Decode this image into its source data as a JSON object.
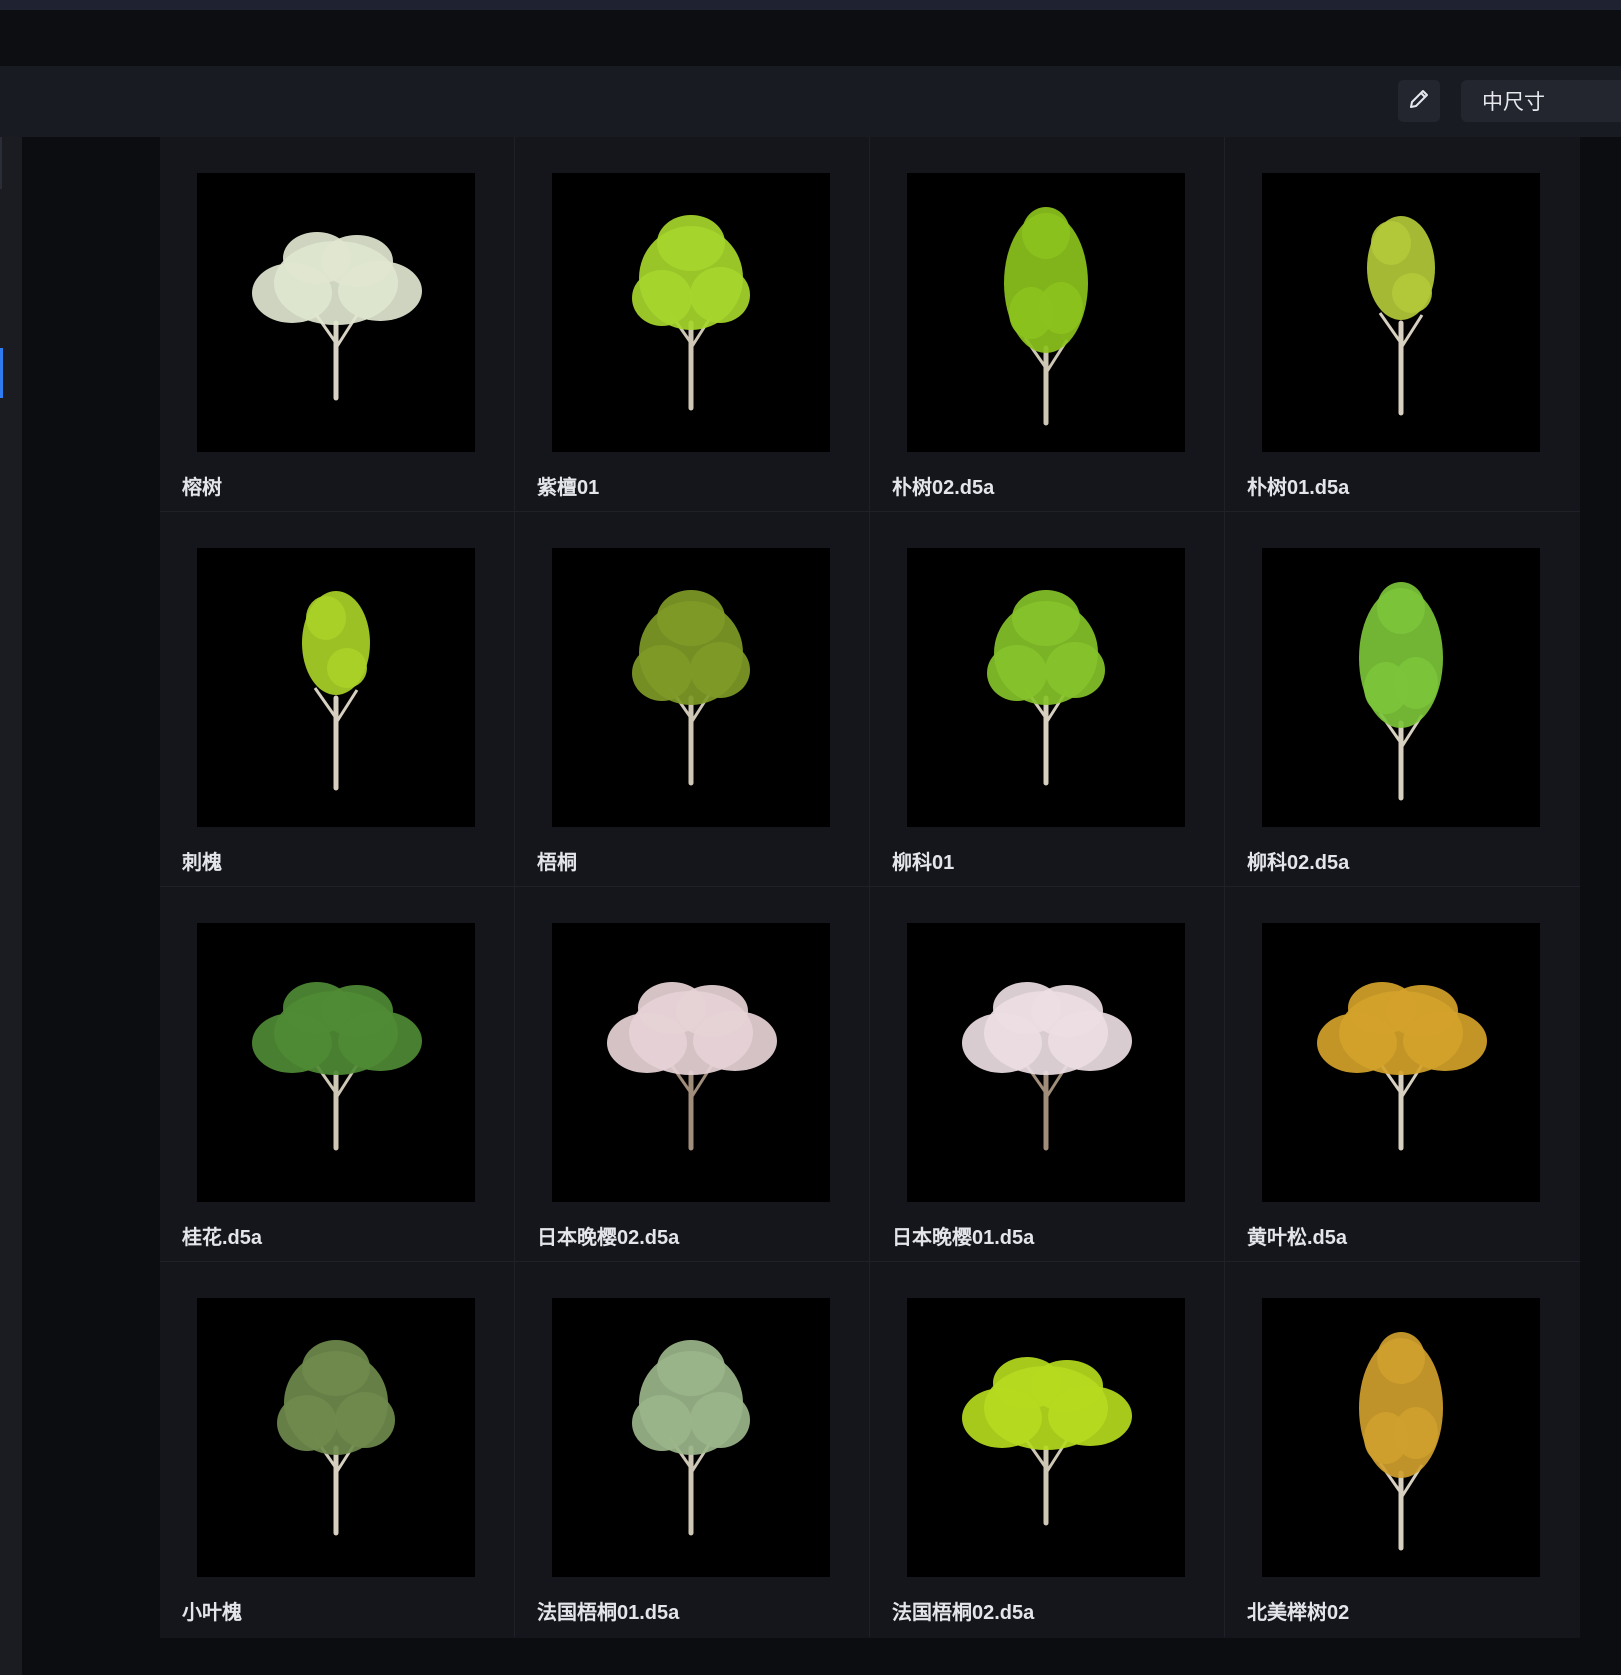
{
  "toolbar": {
    "edit_icon": "pencil-icon",
    "size_select": "中尺寸"
  },
  "assets": [
    {
      "label": "榕树",
      "foliage": "#dfe6cf",
      "trunk": "#d8d2c4",
      "shape": "wide"
    },
    {
      "label": "紫檀01",
      "foliage": "#a6d62c",
      "trunk": "#cfc7b5",
      "shape": "round"
    },
    {
      "label": "朴树02.d5a",
      "foliage": "#8cc21d",
      "trunk": "#cfc7b5",
      "shape": "tall"
    },
    {
      "label": "朴树01.d5a",
      "foliage": "#b3c93a",
      "trunk": "#d7d0c0",
      "shape": "slim"
    },
    {
      "label": "刺槐",
      "foliage": "#a9d127",
      "trunk": "#d7d0c0",
      "shape": "slim"
    },
    {
      "label": "梧桐",
      "foliage": "#7f9a27",
      "trunk": "#cfc7b5",
      "shape": "round"
    },
    {
      "label": "柳科01",
      "foliage": "#86c22a",
      "trunk": "#d7d0c0",
      "shape": "round"
    },
    {
      "label": "柳科02.d5a",
      "foliage": "#7cc43a",
      "trunk": "#d7d0c0",
      "shape": "tall"
    },
    {
      "label": "桂花.d5a",
      "foliage": "#4f8a34",
      "trunk": "#cfc7b5",
      "shape": "wide"
    },
    {
      "label": "日本晚樱02.d5a",
      "foliage": "#e6d2d6",
      "trunk": "#a08d7a",
      "shape": "wide"
    },
    {
      "label": "日本晚樱01.d5a",
      "foliage": "#ecdde2",
      "trunk": "#a08d7a",
      "shape": "wide"
    },
    {
      "label": "黄叶松.d5a",
      "foliage": "#d4a22a",
      "trunk": "#d7d0c0",
      "shape": "wide"
    },
    {
      "label": "小叶槐",
      "foliage": "#6f8a4c",
      "trunk": "#d7d0c0",
      "shape": "round"
    },
    {
      "label": "法国梧桐01.d5a",
      "foliage": "#9bb58a",
      "trunk": "#cfc7b5",
      "shape": "round"
    },
    {
      "label": "法国梧桐02.d5a",
      "foliage": "#b5da1e",
      "trunk": "#cfc7b5",
      "shape": "wide"
    },
    {
      "label": "北美榉树02",
      "foliage": "#cf9f2e",
      "trunk": "#d7d0c0",
      "shape": "tall"
    }
  ]
}
